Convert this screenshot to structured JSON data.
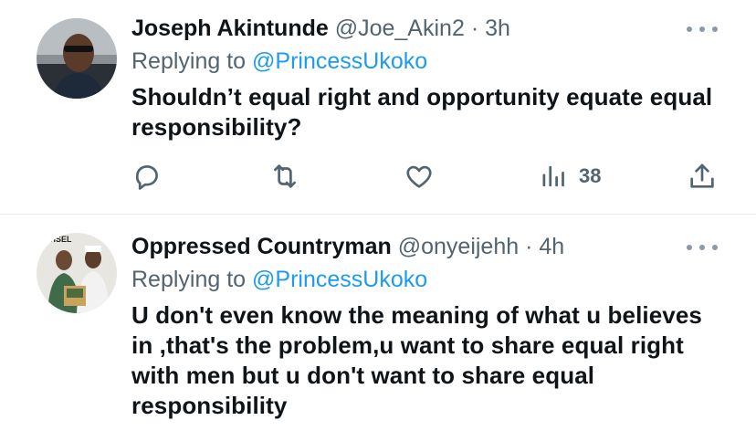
{
  "tweets": [
    {
      "name": "Joseph Akintunde",
      "handle": "@Joe_Akin2",
      "time": "3h",
      "replying_label": "Replying to",
      "replying_to": "@PrincessUkoko",
      "text": "Shouldn’t equal right and opportunity equate equal responsibility?",
      "actions": {
        "views": "38"
      }
    },
    {
      "name": "Oppressed Countryman",
      "handle": "@onyeijehh",
      "time": "4h",
      "replying_label": "Replying to",
      "replying_to": "@PrincessUkoko",
      "text": "U don't even know the meaning of what u believes in ,that's the problem,u want to share equal right with men but u don't want to share equal responsibility",
      "avatar_text": "WISEL"
    }
  ],
  "separator": "·",
  "icons": [
    "reply-icon",
    "retweet-icon",
    "like-icon",
    "views-icon",
    "share-icon",
    "more-icon"
  ],
  "colors": {
    "accent": "#1d9bf0",
    "secondary_text": "#536471",
    "primary_text": "#0f1419"
  }
}
